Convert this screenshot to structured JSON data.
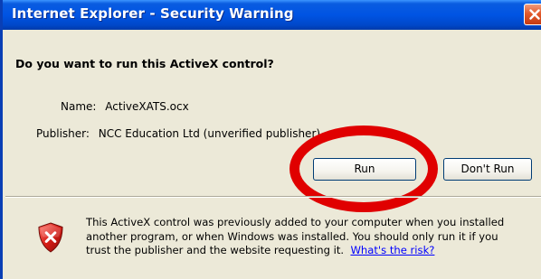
{
  "window": {
    "title": "Internet Explorer - Security Warning",
    "close_icon": "close-icon"
  },
  "dialog": {
    "question": "Do you want to run this ActiveX control?",
    "name_label": "Name:",
    "name_value": "ActiveXATS.ocx",
    "publisher_label": "Publisher:",
    "publisher_value": "NCC Education Ltd (unverified publisher)"
  },
  "buttons": {
    "run_label": "Run",
    "dont_run_label": "Don't Run"
  },
  "warning": {
    "icon": "shield-x-icon",
    "line1": "This ActiveX control was previously added to your computer when you installed",
    "line2": "another program, or when Windows was installed. You should only run it if you",
    "line3": "trust the publisher and the website requesting it.",
    "link_text": "What's the risk?"
  },
  "colors": {
    "titlebar": "#0054e3",
    "dialog_bg": "#ece9d8",
    "highlight_ring": "#e00000",
    "link": "#0000ff"
  }
}
